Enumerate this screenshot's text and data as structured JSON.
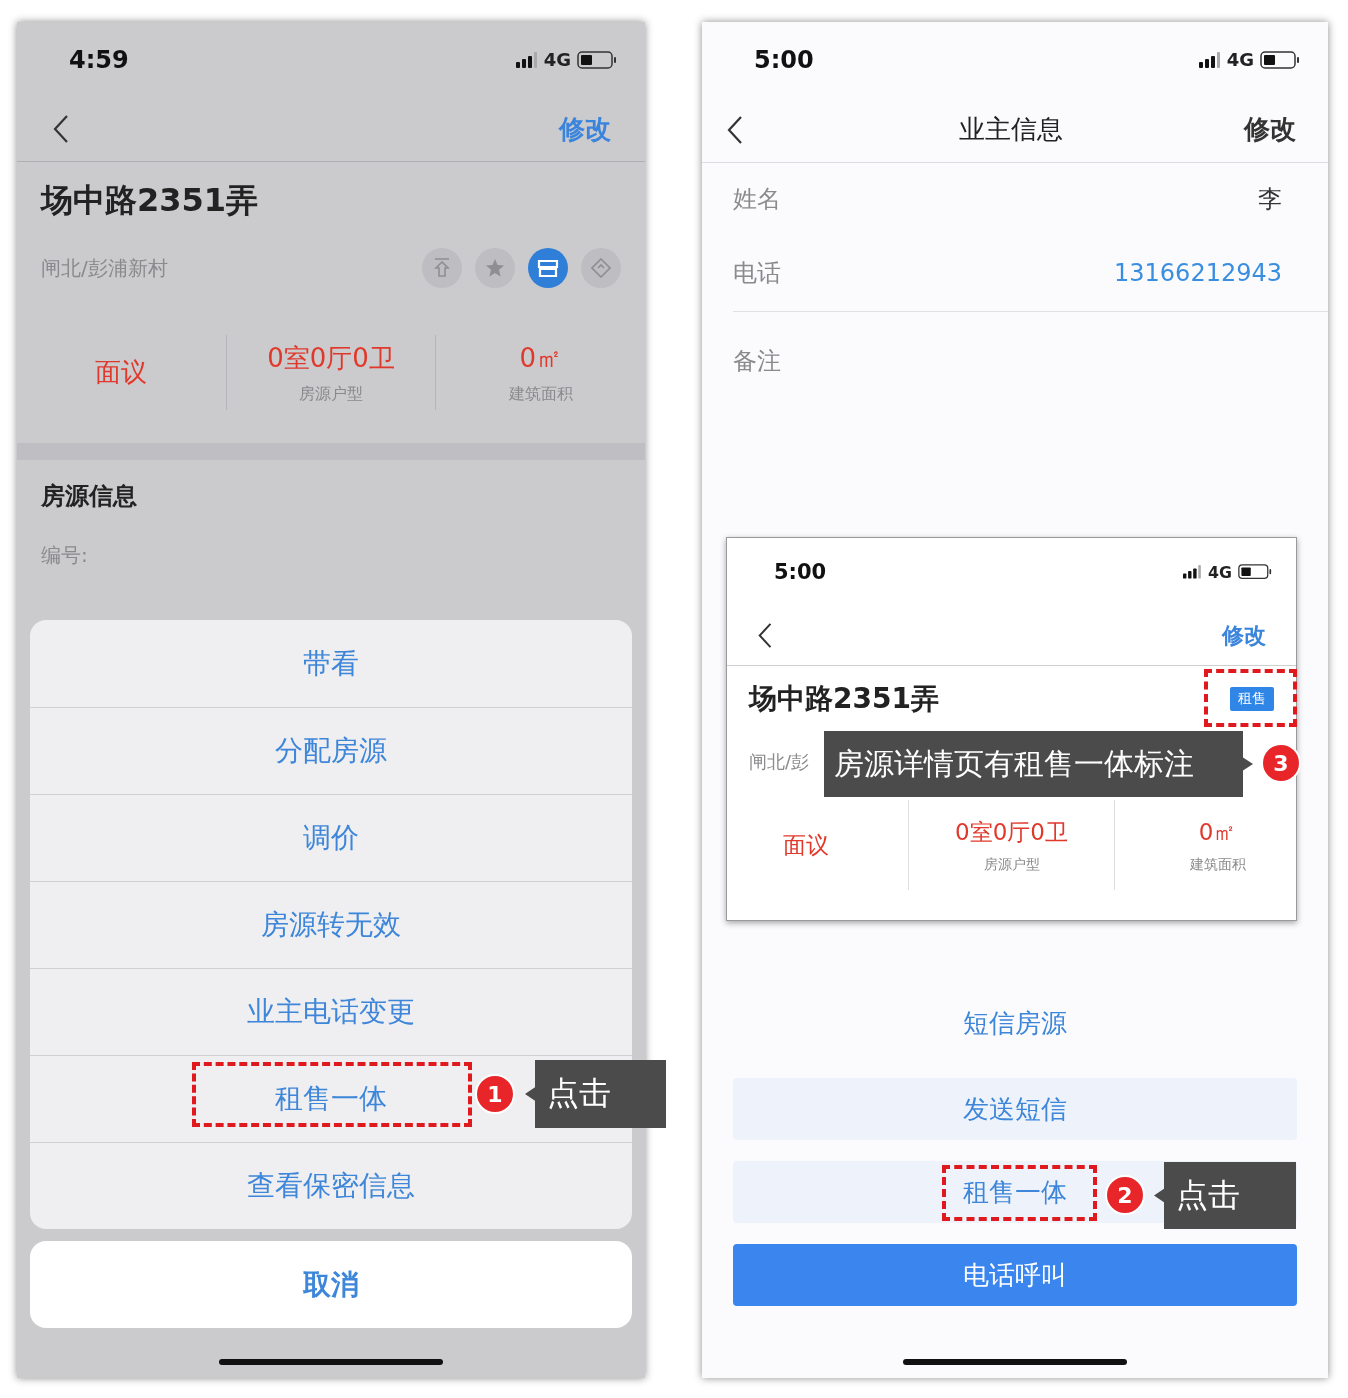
{
  "left_screen": {
    "status_bar": {
      "time": "4:59",
      "network": "4G"
    },
    "nav": {
      "action": "修改"
    },
    "listing": {
      "title": "场中路2351弄",
      "location": "闸北/彭浦新村",
      "tag_icons": [
        {
          "kind": "top",
          "selected": false
        },
        {
          "kind": "star",
          "selected": false
        },
        {
          "kind": "store",
          "selected": true
        },
        {
          "kind": "tag",
          "selected": false
        }
      ],
      "stats": [
        {
          "value": "面议"
        },
        {
          "value": "0室0厅0卫",
          "label": "房源户型"
        },
        {
          "value": "0㎡",
          "label": "建筑面积"
        }
      ]
    },
    "section": {
      "title": "房源信息",
      "fields": [
        "编号:"
      ]
    },
    "action_sheet": {
      "items": [
        "带看",
        "分配房源",
        "调价",
        "房源转无效",
        "业主电话变更",
        "租售一体",
        "查看保密信息"
      ],
      "cancel": "取消"
    }
  },
  "right_screen": {
    "status_bar": {
      "time": "5:00",
      "network": "4G"
    },
    "nav": {
      "title": "业主信息",
      "action": "修改"
    },
    "fields": [
      {
        "kind": "text",
        "label": "姓名",
        "value": "李"
      },
      {
        "kind": "link",
        "label": "电话",
        "value": "13166212943"
      },
      {
        "kind": "note",
        "label": "备注"
      }
    ],
    "inset": {
      "status_bar": {
        "time": "5:00",
        "network": "4G"
      },
      "nav": {
        "action": "修改"
      },
      "title": "场中路2351弄",
      "badge": "租售",
      "location": "闸北/彭",
      "stats": [
        {
          "value": "面议"
        },
        {
          "value": "0室0厅0卫",
          "label": "房源户型"
        },
        {
          "value": "0㎡",
          "label": "建筑面积"
        }
      ]
    },
    "sms_title": "短信房源",
    "buttons": [
      {
        "kind": "secondary",
        "label": "发送短信"
      },
      {
        "kind": "secondary",
        "label": "租售一体"
      },
      {
        "kind": "primary",
        "label": "电话呼叫"
      }
    ]
  },
  "annotations": [
    {
      "number": "1",
      "text": "点击"
    },
    {
      "number": "3",
      "text": "房源详情页有租售一体标注"
    },
    {
      "number": "2",
      "text": "点击"
    }
  ]
}
